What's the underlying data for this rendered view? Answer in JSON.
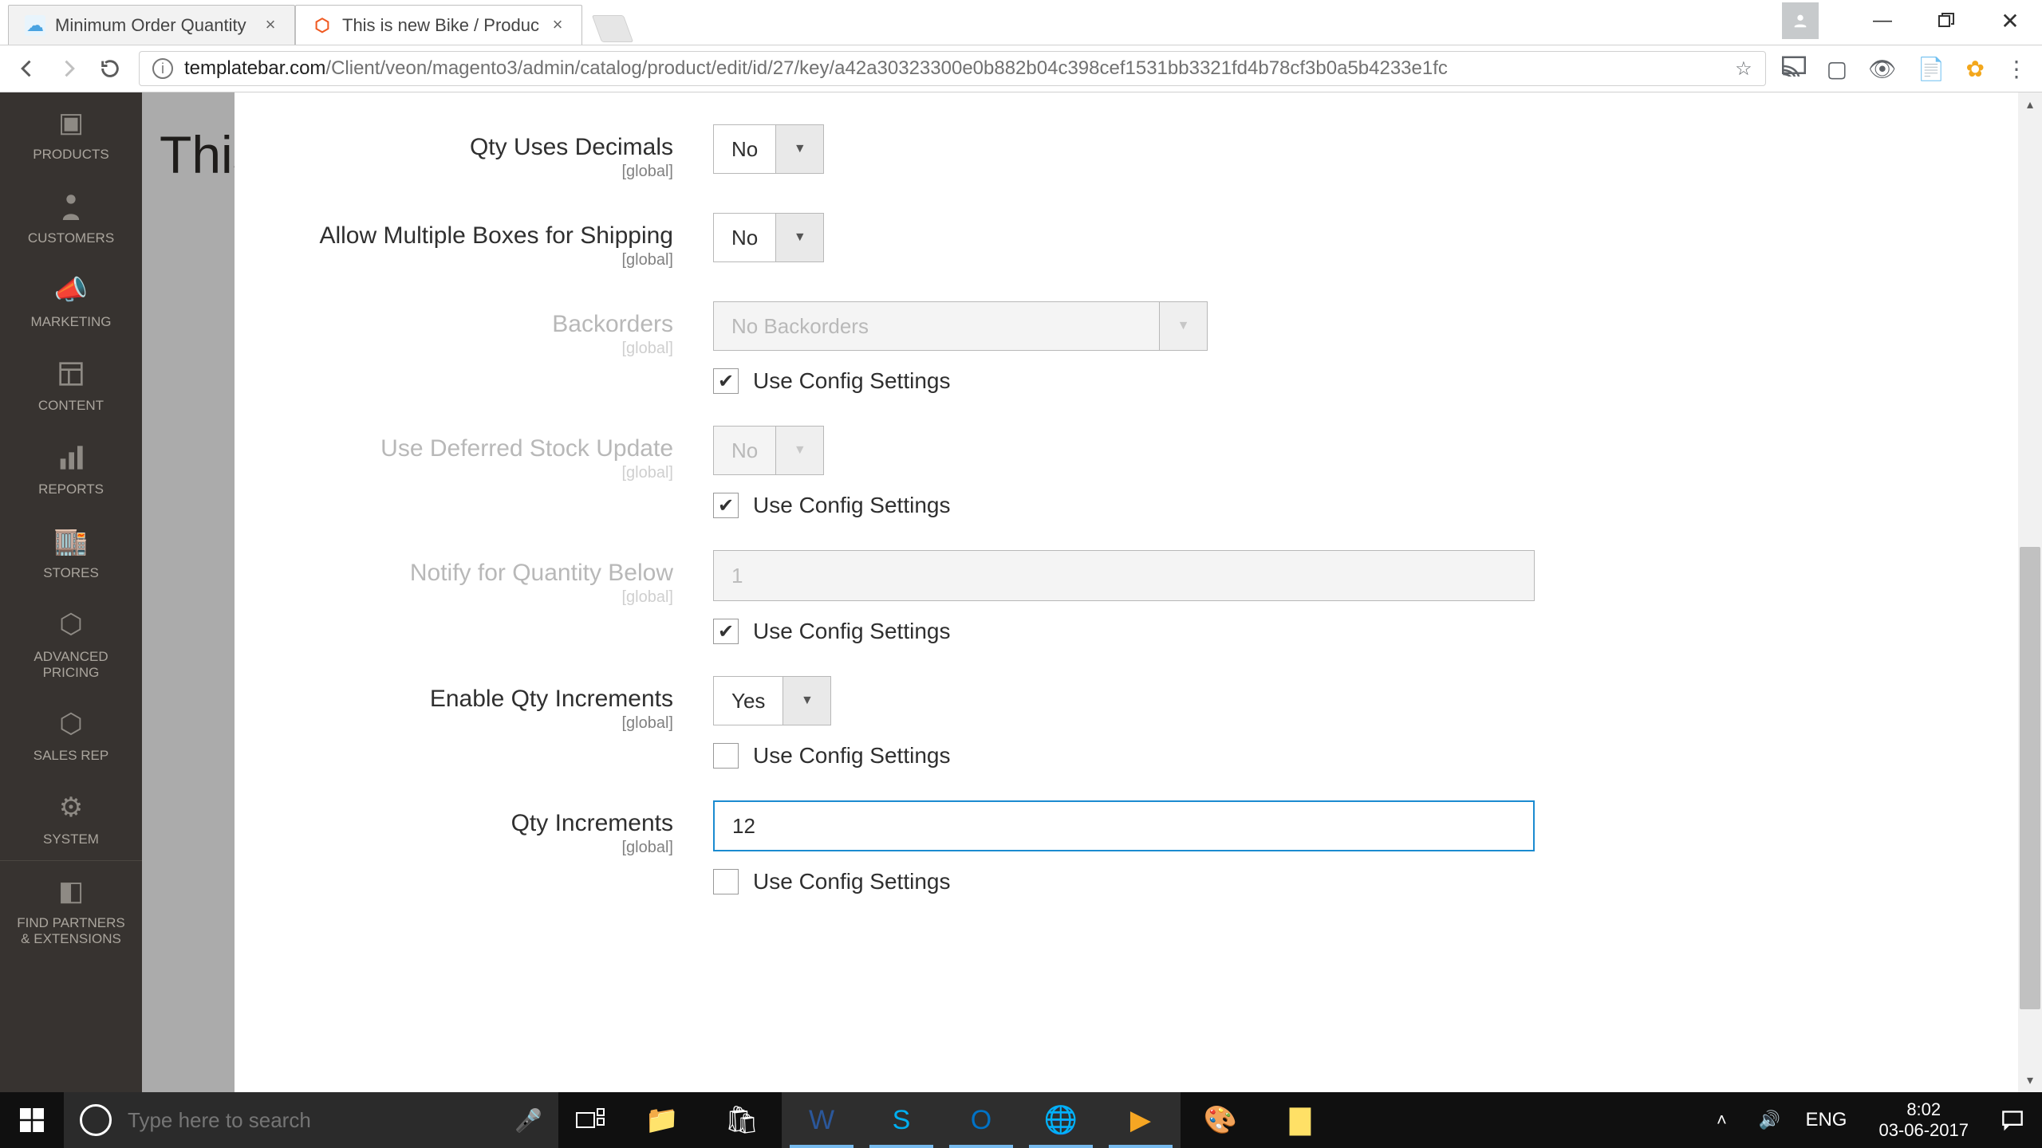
{
  "chrome": {
    "tabs": [
      {
        "title": "Minimum Order Quantity",
        "active": false,
        "favicon_color": "#49a3e1"
      },
      {
        "title": "This is new Bike / Produc",
        "active": true,
        "favicon_color": "#f05a22"
      }
    ],
    "url_prefix": "templatebar.com",
    "url_rest": "/Client/veon/magento3/admin/catalog/product/edit/id/27/key/a42a30323300e0b882b04c398cef1531bb3321fd4b78cf3b0a5b4233e1fc"
  },
  "sidebar": {
    "items": [
      {
        "label": "PRODUCTS",
        "icon": "cube-icon"
      },
      {
        "label": "CUSTOMERS",
        "icon": "person-icon"
      },
      {
        "label": "MARKETING",
        "icon": "megaphone-icon"
      },
      {
        "label": "CONTENT",
        "icon": "layout-icon"
      },
      {
        "label": "REPORTS",
        "icon": "bars-icon"
      },
      {
        "label": "STORES",
        "icon": "storefront-icon"
      },
      {
        "label": "ADVANCED PRICING",
        "icon": "hex-icon"
      },
      {
        "label": "SALES REP",
        "icon": "hex-icon"
      },
      {
        "label": "SYSTEM",
        "icon": "gear-icon"
      },
      {
        "label": "FIND PARTNERS & EXTENSIONS",
        "icon": "blocks-icon"
      }
    ]
  },
  "page": {
    "behind_title": "This",
    "scope": "[global]",
    "fields": {
      "qty_decimals": {
        "label": "Qty Uses Decimals",
        "value": "No",
        "type": "select",
        "disabled": false,
        "has_config": false
      },
      "multi_boxes": {
        "label": "Allow Multiple Boxes for Shipping",
        "value": "No",
        "type": "select",
        "disabled": false,
        "has_config": false
      },
      "backorders": {
        "label": "Backorders",
        "value": "No Backorders",
        "type": "select-wide",
        "disabled": true,
        "has_config": true,
        "config_checked": true
      },
      "deferred_stock": {
        "label": "Use Deferred Stock Update",
        "value": "No",
        "type": "select",
        "disabled": true,
        "has_config": true,
        "config_checked": true
      },
      "notify_below": {
        "label": "Notify for Quantity Below",
        "value": "1",
        "type": "text",
        "disabled": true,
        "has_config": true,
        "config_checked": true
      },
      "enable_qty_inc": {
        "label": "Enable Qty Increments",
        "value": "Yes",
        "type": "select",
        "disabled": false,
        "has_config": true,
        "config_checked": false
      },
      "qty_increments": {
        "label": "Qty Increments",
        "value": "12",
        "type": "text",
        "disabled": false,
        "focused": true,
        "has_config": true,
        "config_checked": false
      }
    },
    "config_label": "Use Config Settings"
  },
  "taskbar": {
    "search_placeholder": "Type here to search",
    "lang": "ENG",
    "time": "8:02",
    "date": "03-06-2017"
  }
}
